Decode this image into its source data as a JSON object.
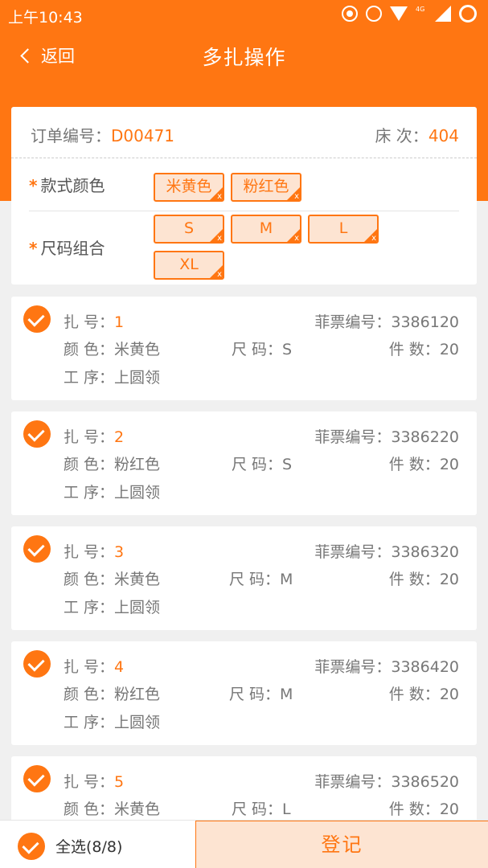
{
  "status_bar": {
    "time": "上午10:43",
    "net_label": "4G"
  },
  "nav": {
    "back_label": "返回",
    "title": "多扎操作"
  },
  "order": {
    "order_label": "订单编号：",
    "order_no": "D00471",
    "bed_label": "床 次：",
    "bed_no": "404"
  },
  "options": {
    "color_label": "款式颜色",
    "size_label": "尺码组合",
    "colors": [
      "米黄色",
      "粉红色"
    ],
    "sizes": [
      "S",
      "M",
      "L",
      "XL"
    ],
    "remove_glyph": "x"
  },
  "labels": {
    "bundle": "扎 号：",
    "ticket": "菲票编号：",
    "color": "颜 色：",
    "size": "尺 码：",
    "qty": "件 数：",
    "process": "工 序："
  },
  "bundles": [
    {
      "no": "1",
      "ticket": "3386120",
      "color": "米黄色",
      "size": "S",
      "qty": "20",
      "process": "上圆领"
    },
    {
      "no": "2",
      "ticket": "3386220",
      "color": "粉红色",
      "size": "S",
      "qty": "20",
      "process": "上圆领"
    },
    {
      "no": "3",
      "ticket": "3386320",
      "color": "米黄色",
      "size": "M",
      "qty": "20",
      "process": "上圆领"
    },
    {
      "no": "4",
      "ticket": "3386420",
      "color": "粉红色",
      "size": "M",
      "qty": "20",
      "process": "上圆领"
    },
    {
      "no": "5",
      "ticket": "3386520",
      "color": "米黄色",
      "size": "L",
      "qty": "20",
      "process": ""
    }
  ],
  "footer": {
    "select_all": "全选(8/8)",
    "register": "登记"
  },
  "colors": {
    "accent": "#ff7612",
    "chip_bg": "#fde4d2",
    "page_bg": "#f0f0f0"
  }
}
